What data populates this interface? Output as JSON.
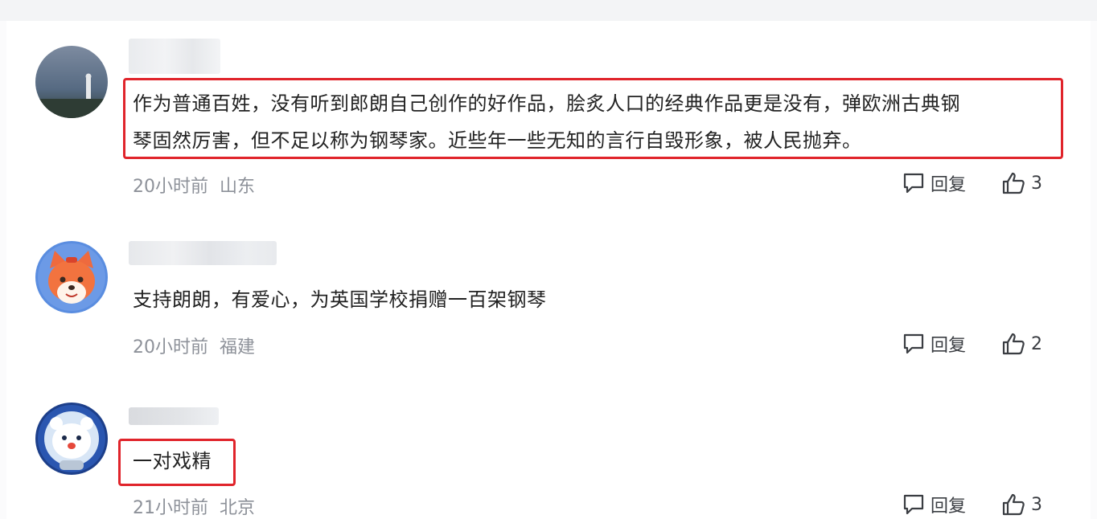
{
  "comments": [
    {
      "text_lines": [
        "作为普通百姓，没有听到郎朗自己创作的好作品，脍炙人口的经典作品更是没有，弹欧洲古典钢",
        "琴固然厉害，但不足以称为钢琴家。近些年一些无知的言行自毁形象，被人民抛弃。"
      ],
      "time": "20小时前",
      "location": "山东",
      "reply_label": "回复",
      "likes": "3",
      "avatar_icon": "landscape-avatar-icon",
      "highlighted": true
    },
    {
      "text_lines": [
        "支持朗朗，有爱心，为英国学校捐赠一百架钢琴"
      ],
      "time": "20小时前",
      "location": "福建",
      "reply_label": "回复",
      "likes": "2",
      "avatar_icon": "fox-avatar-icon",
      "highlighted": false
    },
    {
      "text_lines": [
        "一对戏精"
      ],
      "time": "21小时前",
      "location": "北京",
      "reply_label": "回复",
      "likes": "3",
      "avatar_icon": "bear-avatar-icon",
      "highlighted": true
    }
  ],
  "colors": {
    "highlight": "#e0242b",
    "meta_text": "#8d9199",
    "body_text": "#222222"
  }
}
